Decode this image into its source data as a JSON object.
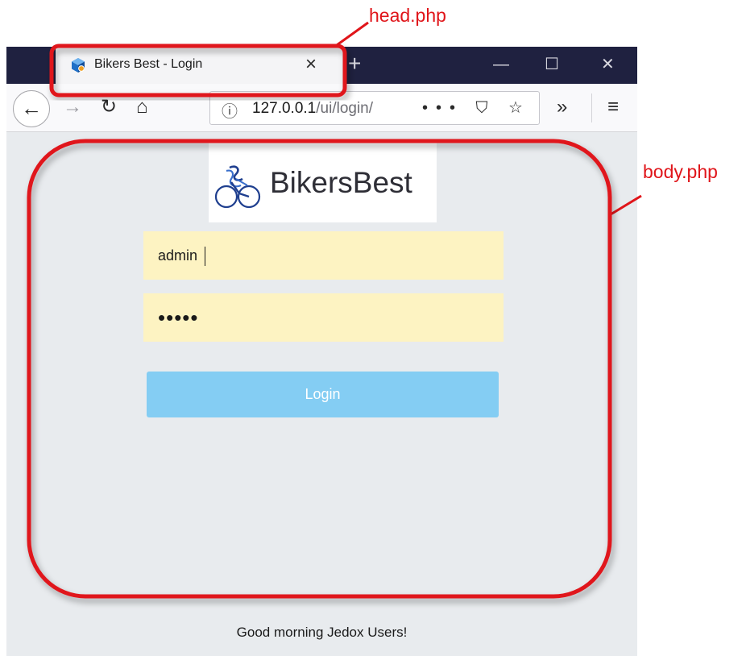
{
  "annotations": {
    "head_label": "head.php",
    "body_label": "body.php",
    "color": "#e0151a"
  },
  "browser": {
    "tab": {
      "title": "Bikers Best - Login",
      "close": "×",
      "favicon": "jedox-cube-icon"
    },
    "new_tab": "+",
    "window_controls": {
      "minimize": "—",
      "maximize": "☐",
      "close": "✕"
    },
    "nav": {
      "back": "←",
      "forward": "→",
      "reload": "↻",
      "home": "⌂",
      "info": "ⓘ",
      "overflow": "»",
      "menu": "≡",
      "page_actions": "••• ⛉ ☆"
    },
    "url": {
      "host": "127.0.0.1",
      "path": "/ui/login/"
    }
  },
  "page": {
    "logo_text": "BikersBest",
    "username_value": "admin",
    "password_mask": "•••••",
    "login_label": "Login",
    "greeting": "Good morning Jedox Users!"
  },
  "colors": {
    "titlebar": "#1f2140",
    "page_bg": "#e8ebee",
    "input_bg": "#fdf3c2",
    "button_bg": "#84cdf3"
  }
}
